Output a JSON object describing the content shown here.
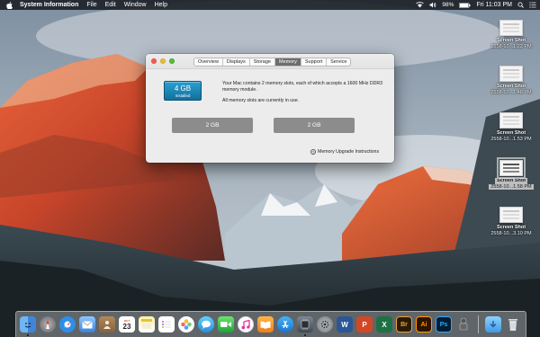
{
  "menubar": {
    "app_name": "System Information",
    "menus": [
      "File",
      "Edit",
      "Window",
      "Help"
    ],
    "battery_percent": "98%",
    "clock": "Fri 11:03 PM"
  },
  "desktop_icons": [
    {
      "line1": "Screen Shot",
      "line2": "2558-10...1.22 PM"
    },
    {
      "line1": "Screen Shot",
      "line2": "2558-10...1.48 PM"
    },
    {
      "line1": "Screen Shot",
      "line2": "2558-10...1.53 PM"
    },
    {
      "line1": "Screen Shot",
      "line2": "2558-10...1.58 PM"
    },
    {
      "line1": "Screen Shot",
      "line2": "2558-10...3.10 PM"
    }
  ],
  "window": {
    "tabs": [
      "Overview",
      "Displays",
      "Storage",
      "Memory",
      "Support",
      "Service"
    ],
    "active_tab": "Memory",
    "memory_size": "4 GB",
    "memory_status": "Installed",
    "description_1": "Your Mac contains 2 memory slots, each of which accepts a 1600 MHz DDR3 memory module.",
    "description_2": "All memory slots are currently in use.",
    "slots": [
      "2 GB",
      "2 GB"
    ],
    "upgrade_link": "Memory Upgrade Instructions"
  },
  "dock": {
    "calendar_month": "OCT",
    "calendar_day": "23",
    "items": [
      "finder-icon",
      "launchpad-icon",
      "safari-icon",
      "mail-icon",
      "contacts-icon",
      "calendar-icon",
      "notes-icon",
      "reminders-icon",
      "photos-icon",
      "messages-icon",
      "facetime-icon",
      "itunes-icon",
      "ibooks-icon",
      "app-store-icon",
      "system-information-icon",
      "system-preferences-icon",
      "word-icon",
      "powerpoint-icon",
      "excel-icon",
      "bridge-icon",
      "illustrator-icon",
      "photoshop-icon",
      "automator-icon",
      "downloads-folder-icon",
      "trash-icon"
    ],
    "labels": {
      "word": "W",
      "powerpoint": "P",
      "excel": "X",
      "bridge": "Br",
      "illustrator": "Ai",
      "photoshop": "Ps"
    }
  },
  "colors": {
    "memory_badge": "#1e8cbf",
    "active_tab": "#6d6d6d",
    "slot": "#8c8c8c"
  }
}
